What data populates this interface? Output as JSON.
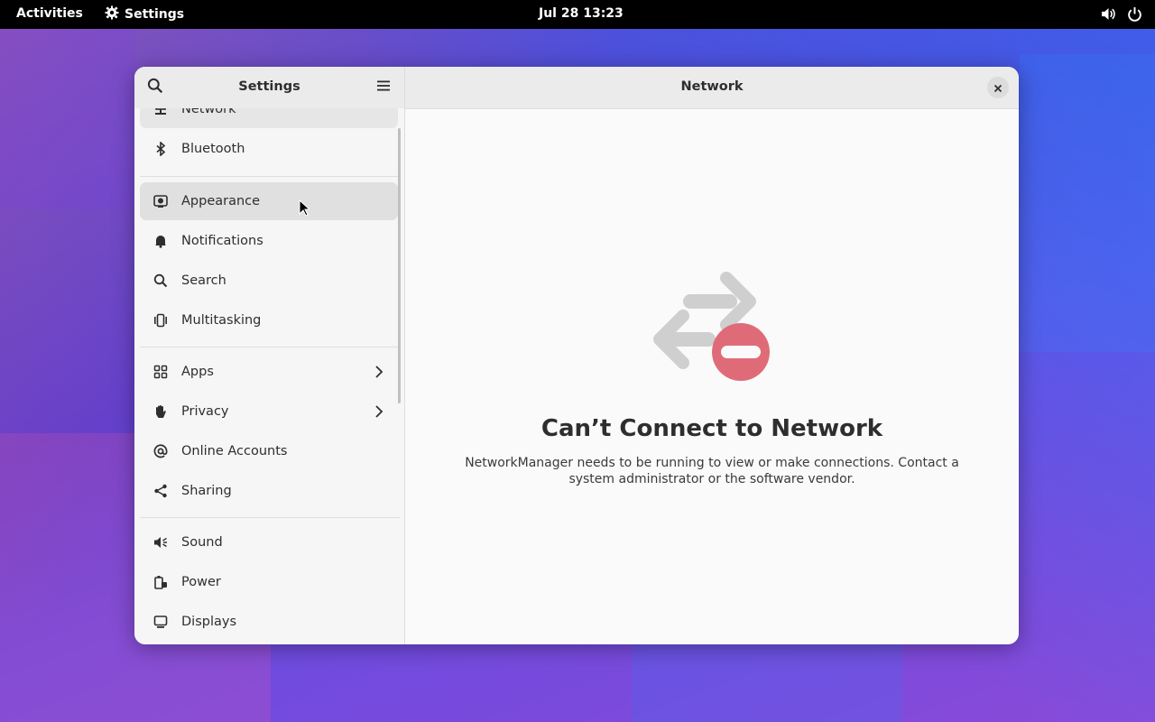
{
  "topbar": {
    "activities_label": "Activities",
    "app_name": "Settings",
    "clock": "Jul 28  13:23",
    "icons": [
      "volume-icon",
      "power-icon"
    ]
  },
  "sidebar": {
    "title": "Settings",
    "items": [
      {
        "label": "Network",
        "icon": "network-icon"
      },
      {
        "label": "Bluetooth",
        "icon": "bluetooth-icon"
      },
      {
        "label": "Appearance",
        "icon": "appearance-icon",
        "selected": true
      },
      {
        "label": "Notifications",
        "icon": "bell-icon"
      },
      {
        "label": "Search",
        "icon": "search-icon"
      },
      {
        "label": "Multitasking",
        "icon": "multitasking-icon"
      },
      {
        "label": "Apps",
        "icon": "apps-grid-icon",
        "has_submenu": true
      },
      {
        "label": "Privacy",
        "icon": "hand-icon",
        "has_submenu": true
      },
      {
        "label": "Online Accounts",
        "icon": "at-icon"
      },
      {
        "label": "Sharing",
        "icon": "share-icon"
      },
      {
        "label": "Sound",
        "icon": "speaker-icon"
      },
      {
        "label": "Power",
        "icon": "battery-plug-icon"
      },
      {
        "label": "Displays",
        "icon": "display-icon"
      }
    ]
  },
  "content": {
    "title": "Network",
    "empty_state": {
      "heading": "Can’t Connect to Network",
      "description": "NetworkManager needs to be running to view or make connections. Contact a system administrator or the software vendor."
    }
  },
  "colors": {
    "topbar_bg": "#000000",
    "error_badge": "#e06b78",
    "arrow_gray": "#cfcfcf"
  }
}
